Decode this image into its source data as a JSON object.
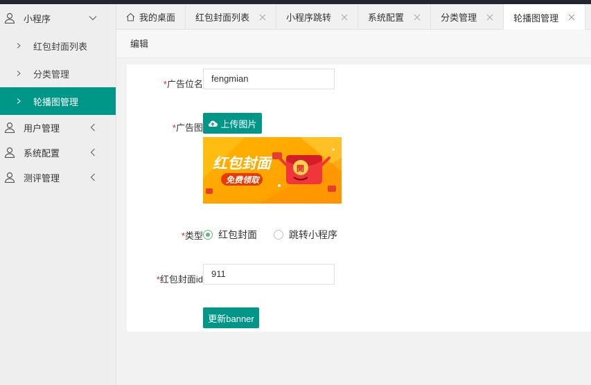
{
  "sidebar": {
    "group_mini": "小程序",
    "sub_items": [
      "红包封面列表",
      "分类管理",
      "轮播图管理"
    ],
    "group_users": "用户管理",
    "group_system": "系统配置",
    "group_eval": "测评管理"
  },
  "tabs": [
    {
      "label": "我的桌面"
    },
    {
      "label": "红包封面列表"
    },
    {
      "label": "小程序跳转"
    },
    {
      "label": "系统配置"
    },
    {
      "label": "分类管理"
    },
    {
      "label": "轮播图管理"
    }
  ],
  "breadcrumb": "编辑",
  "form": {
    "required_mark": "*",
    "ad_position_label": "广告位名",
    "ad_position_value": "fengmian",
    "ad_image_label": "广告图",
    "upload_label": "上传图片",
    "banner_title": "红包封面",
    "banner_sub": "免费领取",
    "banner_envelope_char": "開",
    "type_label": "类型",
    "type_options": [
      "红包封面",
      "跳转小程序"
    ],
    "type_selected": "红包封面",
    "cover_id_label": "红包封面id",
    "cover_id_value": "911",
    "submit_label": "更新banner"
  },
  "colors": {
    "accent": "#009688",
    "radio_on": "#5fb878",
    "required": "#e2231a",
    "topbar": "#23262e"
  }
}
